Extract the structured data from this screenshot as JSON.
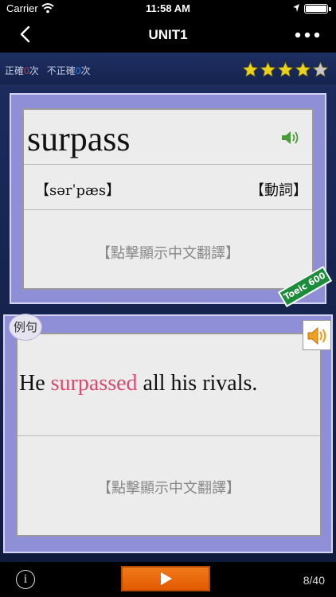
{
  "status": {
    "carrier": "Carrier",
    "time": "11:58 AM",
    "icons": [
      "wifi-icon",
      "location-icon",
      "battery-icon"
    ]
  },
  "nav": {
    "title": "UNIT1",
    "back_icon": "chevron-left-icon",
    "more_icon": "more-horizontal-icon"
  },
  "score": {
    "correct_label": "正確",
    "correct_count": "0",
    "count_unit": "次",
    "wrong_label": "不正確",
    "wrong_count": "0",
    "colors": {
      "correct": "#e02f2f",
      "wrong": "#2f8bf0"
    }
  },
  "rating": {
    "value": 4,
    "max": 5,
    "filled_color": "#e8d21e",
    "empty_color": "#c7c7c7"
  },
  "word_card": {
    "word": "surpass",
    "phonetic": "【sərˈpæs】",
    "part_of_speech": "【動詞】",
    "translation_prompt": "【點擊顯示中文翻譯】",
    "badge": "Toeic 600"
  },
  "example_card": {
    "label": "例句",
    "sentence_before": "He ",
    "sentence_highlight": "surpassed",
    "sentence_after": " all his rivals.",
    "highlight_color": "#d94a72",
    "translation_prompt": "【點擊顯示中文翻譯】"
  },
  "toolbar": {
    "info_label": "i",
    "play_icon": "play-icon",
    "counter": "8/40"
  }
}
